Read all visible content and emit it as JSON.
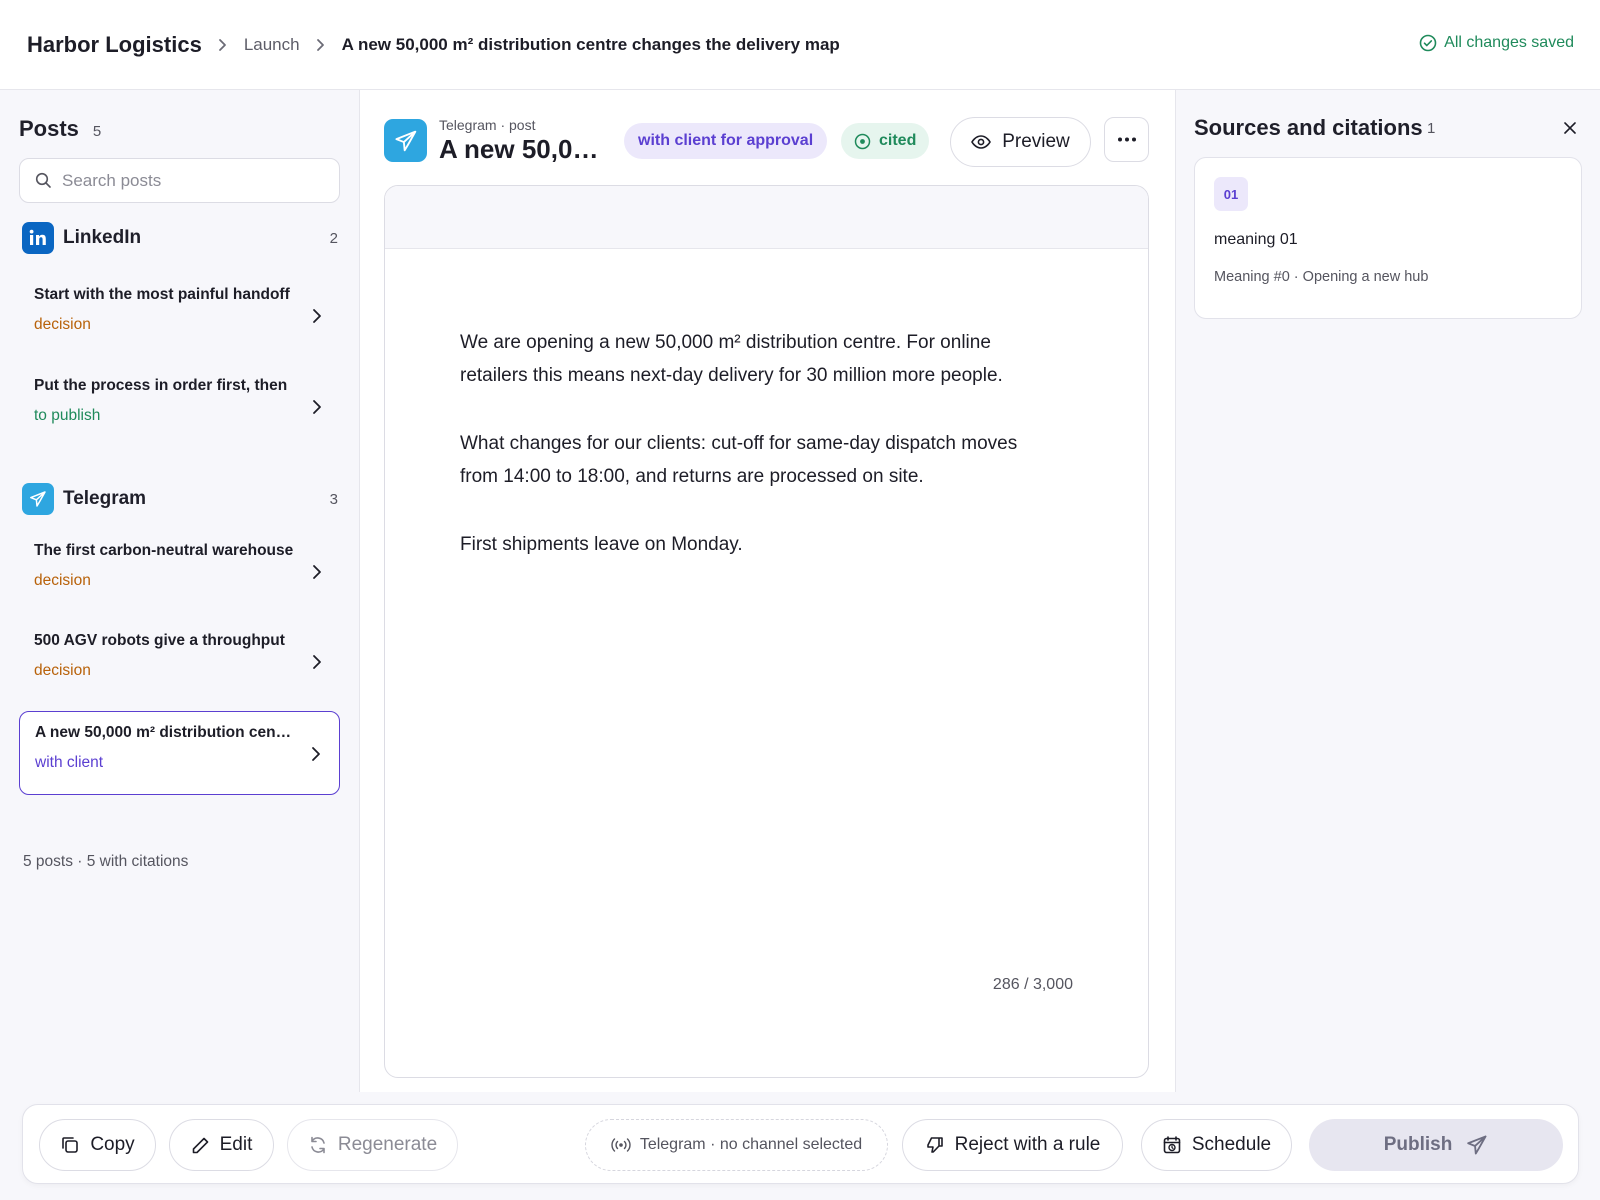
{
  "header": {
    "brand": "Harbor Logistics",
    "breadcrumb": [
      "Launch",
      "A new 50,000 m² distribution centre changes the delivery map"
    ],
    "saved_status": "All changes saved"
  },
  "sidebar": {
    "title": "Posts",
    "count": "5",
    "search_placeholder": "Search posts",
    "groups": [
      {
        "name": "LinkedIn",
        "count": "2",
        "color": "#0a66c2",
        "posts": [
          {
            "title": "Start with the most painful handoff",
            "status": "decision"
          },
          {
            "title": "Put the process in order first, then",
            "status": "to publish"
          }
        ]
      },
      {
        "name": "Telegram",
        "count": "3",
        "color": "#2ea6e0",
        "posts": [
          {
            "title": "The first carbon-neutral warehouse",
            "status": "decision"
          },
          {
            "title": "500 AGV robots give a throughput",
            "status": "decision"
          },
          {
            "title": "A new 50,000 m² distribution centre",
            "status": "with client"
          }
        ]
      }
    ],
    "footer": "5 posts · 5 with citations"
  },
  "editor": {
    "subtitle": "Telegram · post",
    "title": "A new 50,000 m² distribution centre changes the delivery map",
    "badge_approval": "with client for approval",
    "badge_cited": "cited",
    "preview_label": "Preview",
    "paragraphs": [
      "We are opening a new 50,000 m² distribution centre. For online retailers this means next-day delivery for 30 million more people.",
      "What changes for our clients: cut-off for same-day dispatch moves from 14:00 to 18:00, and returns are processed on site.",
      "First shipments leave on Monday."
    ],
    "char_count": "286 / 3,000"
  },
  "sources": {
    "title": "Sources and citations",
    "count": "1",
    "items": [
      {
        "number": "01",
        "title": "meaning 01",
        "meta": "Meaning #0 · Opening a new hub"
      }
    ]
  },
  "actions": {
    "copy": "Copy",
    "edit": "Edit",
    "regenerate": "Regenerate",
    "channel": "Telegram · no channel selected",
    "reject": "Reject with a rule",
    "schedule": "Schedule",
    "publish": "Publish"
  },
  "colors": {
    "accent": "#5b3fd1",
    "success": "#1f8a5b",
    "warning": "#b8620a",
    "telegram": "#2ea6e0",
    "linkedin": "#0a66c2"
  }
}
